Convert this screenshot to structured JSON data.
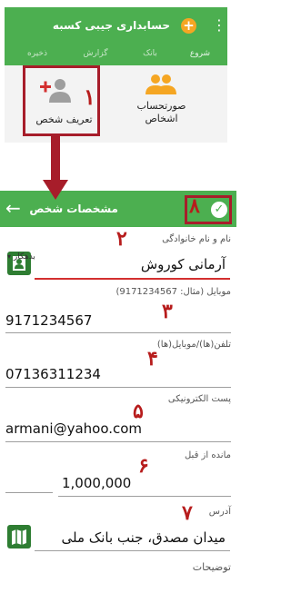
{
  "top_screen": {
    "app_title": "حسابداری جیبی کسبه",
    "menu_icon": "more-vert-icon",
    "add_icon": "add-icon",
    "tabs": [
      "شروع",
      "بانک",
      "گزارش",
      "ذخیره"
    ],
    "tiles": [
      {
        "label": "تعریف شخص",
        "icon": "person-add-icon"
      },
      {
        "label": "صورتحساب اشخاص",
        "icon": "group-icon"
      }
    ],
    "step_number": "۱"
  },
  "form_screen": {
    "title": "مشخصات شخص",
    "back_icon": "arrow-back-icon",
    "confirm_icon": "check-circle-icon",
    "confirm_step": "۸",
    "fields": {
      "name": {
        "label": "نام و نام خانوادگی",
        "value": "آرمانی کوروش",
        "step": "۲"
      },
      "mobile": {
        "label": "موبایل (مثال: 9171234567)",
        "value": "9171234567",
        "step": "۳"
      },
      "phone": {
        "label": "تلفن(ها)/موبایل(ها)",
        "value": "07136311234",
        "step": "۴"
      },
      "email": {
        "label": "پست الکترونیکی",
        "value": "armani@yahoo.com",
        "step": "۵"
      },
      "balance": {
        "label": "مانده از قبل",
        "value": "1,000,000",
        "step": "۶",
        "type_selected": "بدهکار"
      },
      "address": {
        "label": "آدرس",
        "value": "میدان مصدق، جنب بانک ملی",
        "step": "۷"
      },
      "notes": {
        "label": "توضیحات"
      }
    }
  },
  "colors": {
    "primary": "#4caf50",
    "accent": "#f5a623",
    "annotation": "#a71d2a"
  }
}
